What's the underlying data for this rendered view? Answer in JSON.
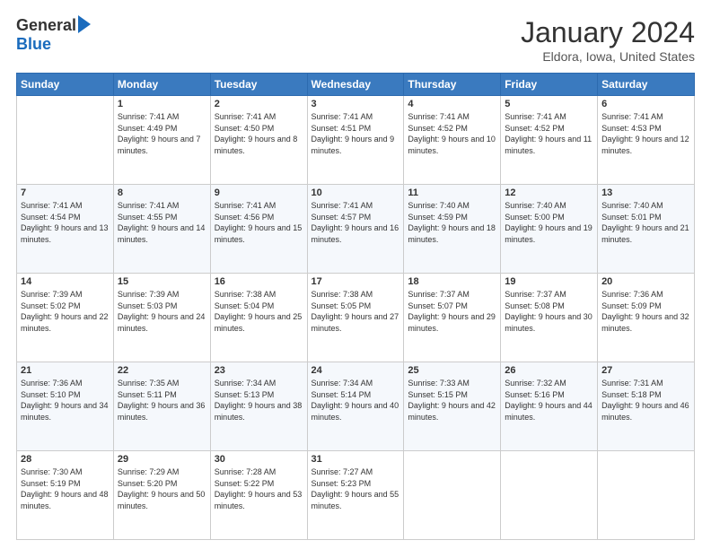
{
  "logo": {
    "general": "General",
    "blue": "Blue"
  },
  "header": {
    "month": "January 2024",
    "location": "Eldora, Iowa, United States"
  },
  "weekdays": [
    "Sunday",
    "Monday",
    "Tuesday",
    "Wednesday",
    "Thursday",
    "Friday",
    "Saturday"
  ],
  "weeks": [
    [
      {
        "day": "",
        "sunrise": "",
        "sunset": "",
        "daylight": ""
      },
      {
        "day": "1",
        "sunrise": "Sunrise: 7:41 AM",
        "sunset": "Sunset: 4:49 PM",
        "daylight": "Daylight: 9 hours and 7 minutes."
      },
      {
        "day": "2",
        "sunrise": "Sunrise: 7:41 AM",
        "sunset": "Sunset: 4:50 PM",
        "daylight": "Daylight: 9 hours and 8 minutes."
      },
      {
        "day": "3",
        "sunrise": "Sunrise: 7:41 AM",
        "sunset": "Sunset: 4:51 PM",
        "daylight": "Daylight: 9 hours and 9 minutes."
      },
      {
        "day": "4",
        "sunrise": "Sunrise: 7:41 AM",
        "sunset": "Sunset: 4:52 PM",
        "daylight": "Daylight: 9 hours and 10 minutes."
      },
      {
        "day": "5",
        "sunrise": "Sunrise: 7:41 AM",
        "sunset": "Sunset: 4:52 PM",
        "daylight": "Daylight: 9 hours and 11 minutes."
      },
      {
        "day": "6",
        "sunrise": "Sunrise: 7:41 AM",
        "sunset": "Sunset: 4:53 PM",
        "daylight": "Daylight: 9 hours and 12 minutes."
      }
    ],
    [
      {
        "day": "7",
        "sunrise": "Sunrise: 7:41 AM",
        "sunset": "Sunset: 4:54 PM",
        "daylight": "Daylight: 9 hours and 13 minutes."
      },
      {
        "day": "8",
        "sunrise": "Sunrise: 7:41 AM",
        "sunset": "Sunset: 4:55 PM",
        "daylight": "Daylight: 9 hours and 14 minutes."
      },
      {
        "day": "9",
        "sunrise": "Sunrise: 7:41 AM",
        "sunset": "Sunset: 4:56 PM",
        "daylight": "Daylight: 9 hours and 15 minutes."
      },
      {
        "day": "10",
        "sunrise": "Sunrise: 7:41 AM",
        "sunset": "Sunset: 4:57 PM",
        "daylight": "Daylight: 9 hours and 16 minutes."
      },
      {
        "day": "11",
        "sunrise": "Sunrise: 7:40 AM",
        "sunset": "Sunset: 4:59 PM",
        "daylight": "Daylight: 9 hours and 18 minutes."
      },
      {
        "day": "12",
        "sunrise": "Sunrise: 7:40 AM",
        "sunset": "Sunset: 5:00 PM",
        "daylight": "Daylight: 9 hours and 19 minutes."
      },
      {
        "day": "13",
        "sunrise": "Sunrise: 7:40 AM",
        "sunset": "Sunset: 5:01 PM",
        "daylight": "Daylight: 9 hours and 21 minutes."
      }
    ],
    [
      {
        "day": "14",
        "sunrise": "Sunrise: 7:39 AM",
        "sunset": "Sunset: 5:02 PM",
        "daylight": "Daylight: 9 hours and 22 minutes."
      },
      {
        "day": "15",
        "sunrise": "Sunrise: 7:39 AM",
        "sunset": "Sunset: 5:03 PM",
        "daylight": "Daylight: 9 hours and 24 minutes."
      },
      {
        "day": "16",
        "sunrise": "Sunrise: 7:38 AM",
        "sunset": "Sunset: 5:04 PM",
        "daylight": "Daylight: 9 hours and 25 minutes."
      },
      {
        "day": "17",
        "sunrise": "Sunrise: 7:38 AM",
        "sunset": "Sunset: 5:05 PM",
        "daylight": "Daylight: 9 hours and 27 minutes."
      },
      {
        "day": "18",
        "sunrise": "Sunrise: 7:37 AM",
        "sunset": "Sunset: 5:07 PM",
        "daylight": "Daylight: 9 hours and 29 minutes."
      },
      {
        "day": "19",
        "sunrise": "Sunrise: 7:37 AM",
        "sunset": "Sunset: 5:08 PM",
        "daylight": "Daylight: 9 hours and 30 minutes."
      },
      {
        "day": "20",
        "sunrise": "Sunrise: 7:36 AM",
        "sunset": "Sunset: 5:09 PM",
        "daylight": "Daylight: 9 hours and 32 minutes."
      }
    ],
    [
      {
        "day": "21",
        "sunrise": "Sunrise: 7:36 AM",
        "sunset": "Sunset: 5:10 PM",
        "daylight": "Daylight: 9 hours and 34 minutes."
      },
      {
        "day": "22",
        "sunrise": "Sunrise: 7:35 AM",
        "sunset": "Sunset: 5:11 PM",
        "daylight": "Daylight: 9 hours and 36 minutes."
      },
      {
        "day": "23",
        "sunrise": "Sunrise: 7:34 AM",
        "sunset": "Sunset: 5:13 PM",
        "daylight": "Daylight: 9 hours and 38 minutes."
      },
      {
        "day": "24",
        "sunrise": "Sunrise: 7:34 AM",
        "sunset": "Sunset: 5:14 PM",
        "daylight": "Daylight: 9 hours and 40 minutes."
      },
      {
        "day": "25",
        "sunrise": "Sunrise: 7:33 AM",
        "sunset": "Sunset: 5:15 PM",
        "daylight": "Daylight: 9 hours and 42 minutes."
      },
      {
        "day": "26",
        "sunrise": "Sunrise: 7:32 AM",
        "sunset": "Sunset: 5:16 PM",
        "daylight": "Daylight: 9 hours and 44 minutes."
      },
      {
        "day": "27",
        "sunrise": "Sunrise: 7:31 AM",
        "sunset": "Sunset: 5:18 PM",
        "daylight": "Daylight: 9 hours and 46 minutes."
      }
    ],
    [
      {
        "day": "28",
        "sunrise": "Sunrise: 7:30 AM",
        "sunset": "Sunset: 5:19 PM",
        "daylight": "Daylight: 9 hours and 48 minutes."
      },
      {
        "day": "29",
        "sunrise": "Sunrise: 7:29 AM",
        "sunset": "Sunset: 5:20 PM",
        "daylight": "Daylight: 9 hours and 50 minutes."
      },
      {
        "day": "30",
        "sunrise": "Sunrise: 7:28 AM",
        "sunset": "Sunset: 5:22 PM",
        "daylight": "Daylight: 9 hours and 53 minutes."
      },
      {
        "day": "31",
        "sunrise": "Sunrise: 7:27 AM",
        "sunset": "Sunset: 5:23 PM",
        "daylight": "Daylight: 9 hours and 55 minutes."
      },
      {
        "day": "",
        "sunrise": "",
        "sunset": "",
        "daylight": ""
      },
      {
        "day": "",
        "sunrise": "",
        "sunset": "",
        "daylight": ""
      },
      {
        "day": "",
        "sunrise": "",
        "sunset": "",
        "daylight": ""
      }
    ]
  ]
}
